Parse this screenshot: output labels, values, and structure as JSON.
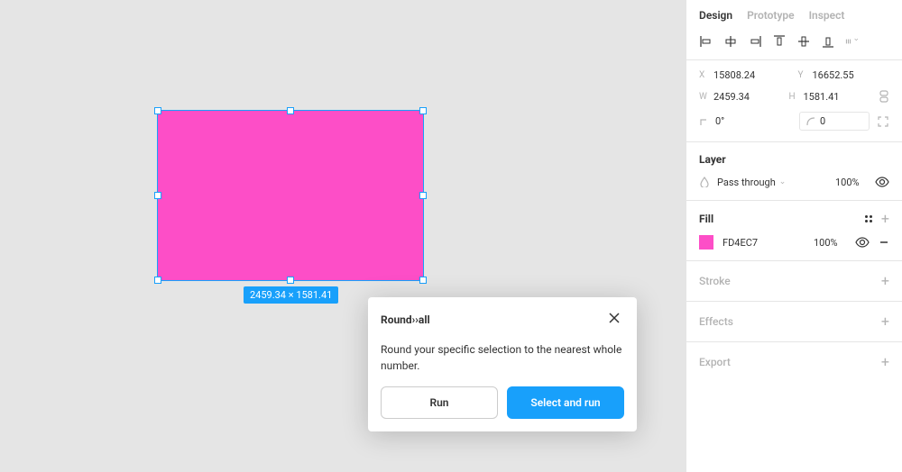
{
  "canvas": {
    "selection_dim_label": "2459.34 × 1581.41",
    "fill_color": "#fd4ec7"
  },
  "modal": {
    "title": "Round››all",
    "body": "Round your specific selection to the nearest whole number.",
    "run_label": "Run",
    "select_run_label": "Select and run"
  },
  "panel": {
    "tabs": {
      "design": "Design",
      "prototype": "Prototype",
      "inspect": "Inspect"
    },
    "geometry": {
      "x_label": "X",
      "x": "15808.24",
      "y_label": "Y",
      "y": "16652.55",
      "w_label": "W",
      "w": "2459.34",
      "h_label": "H",
      "h": "1581.41",
      "rotation": "0°",
      "corner_radius": "0"
    },
    "layer_section": "Layer",
    "layer": {
      "blend_mode": "Pass through",
      "opacity": "100%"
    },
    "fill_section": "Fill",
    "fill": {
      "hex": "FD4EC7",
      "opacity": "100%"
    },
    "stroke_section": "Stroke",
    "effects_section": "Effects",
    "export_section": "Export"
  }
}
